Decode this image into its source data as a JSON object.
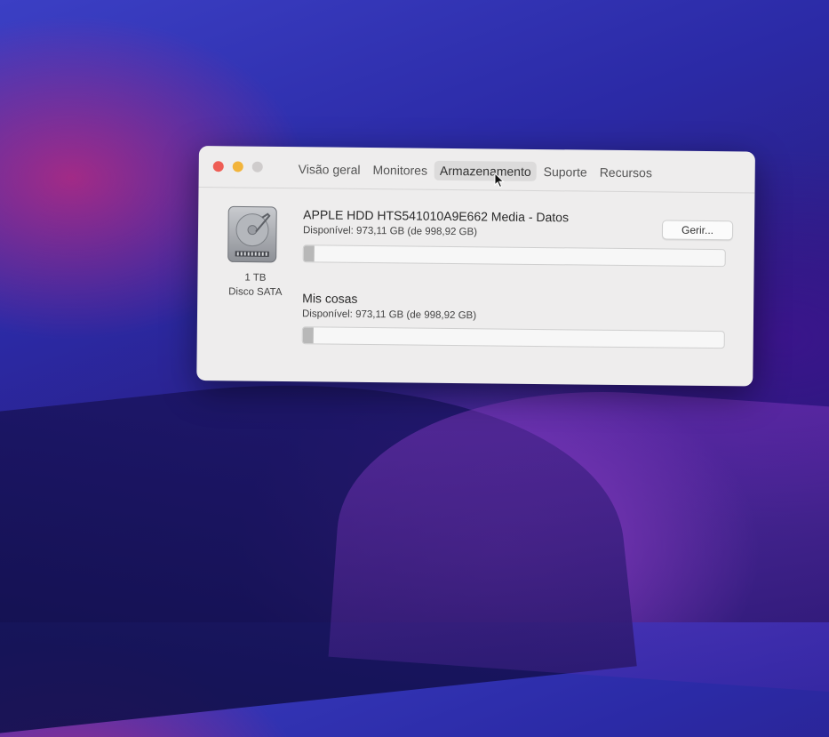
{
  "window": {
    "tabs": [
      {
        "label": "Visão geral",
        "active": false
      },
      {
        "label": "Monitores",
        "active": false
      },
      {
        "label": "Armazenamento",
        "active": true
      },
      {
        "label": "Suporte",
        "active": false
      },
      {
        "label": "Recursos",
        "active": false
      }
    ]
  },
  "disk": {
    "icon": "hard-drive-icon",
    "capacity": "1 TB",
    "type": "Disco SATA"
  },
  "volumes": [
    {
      "name": "APPLE HDD HTS541010A9E662 Media - Datos",
      "available": "Disponível: 973,11 GB (de 998,92 GB)",
      "used_fraction": 0.026
    },
    {
      "name": "Mis cosas",
      "available": "Disponível: 973,11 GB (de 998,92 GB)",
      "used_fraction": 0.026
    }
  ],
  "actions": {
    "manage_label": "Gerir..."
  },
  "colors": {
    "close": "#ee5d55",
    "minimize": "#f2b43b",
    "maximize": "#cfcccc"
  }
}
